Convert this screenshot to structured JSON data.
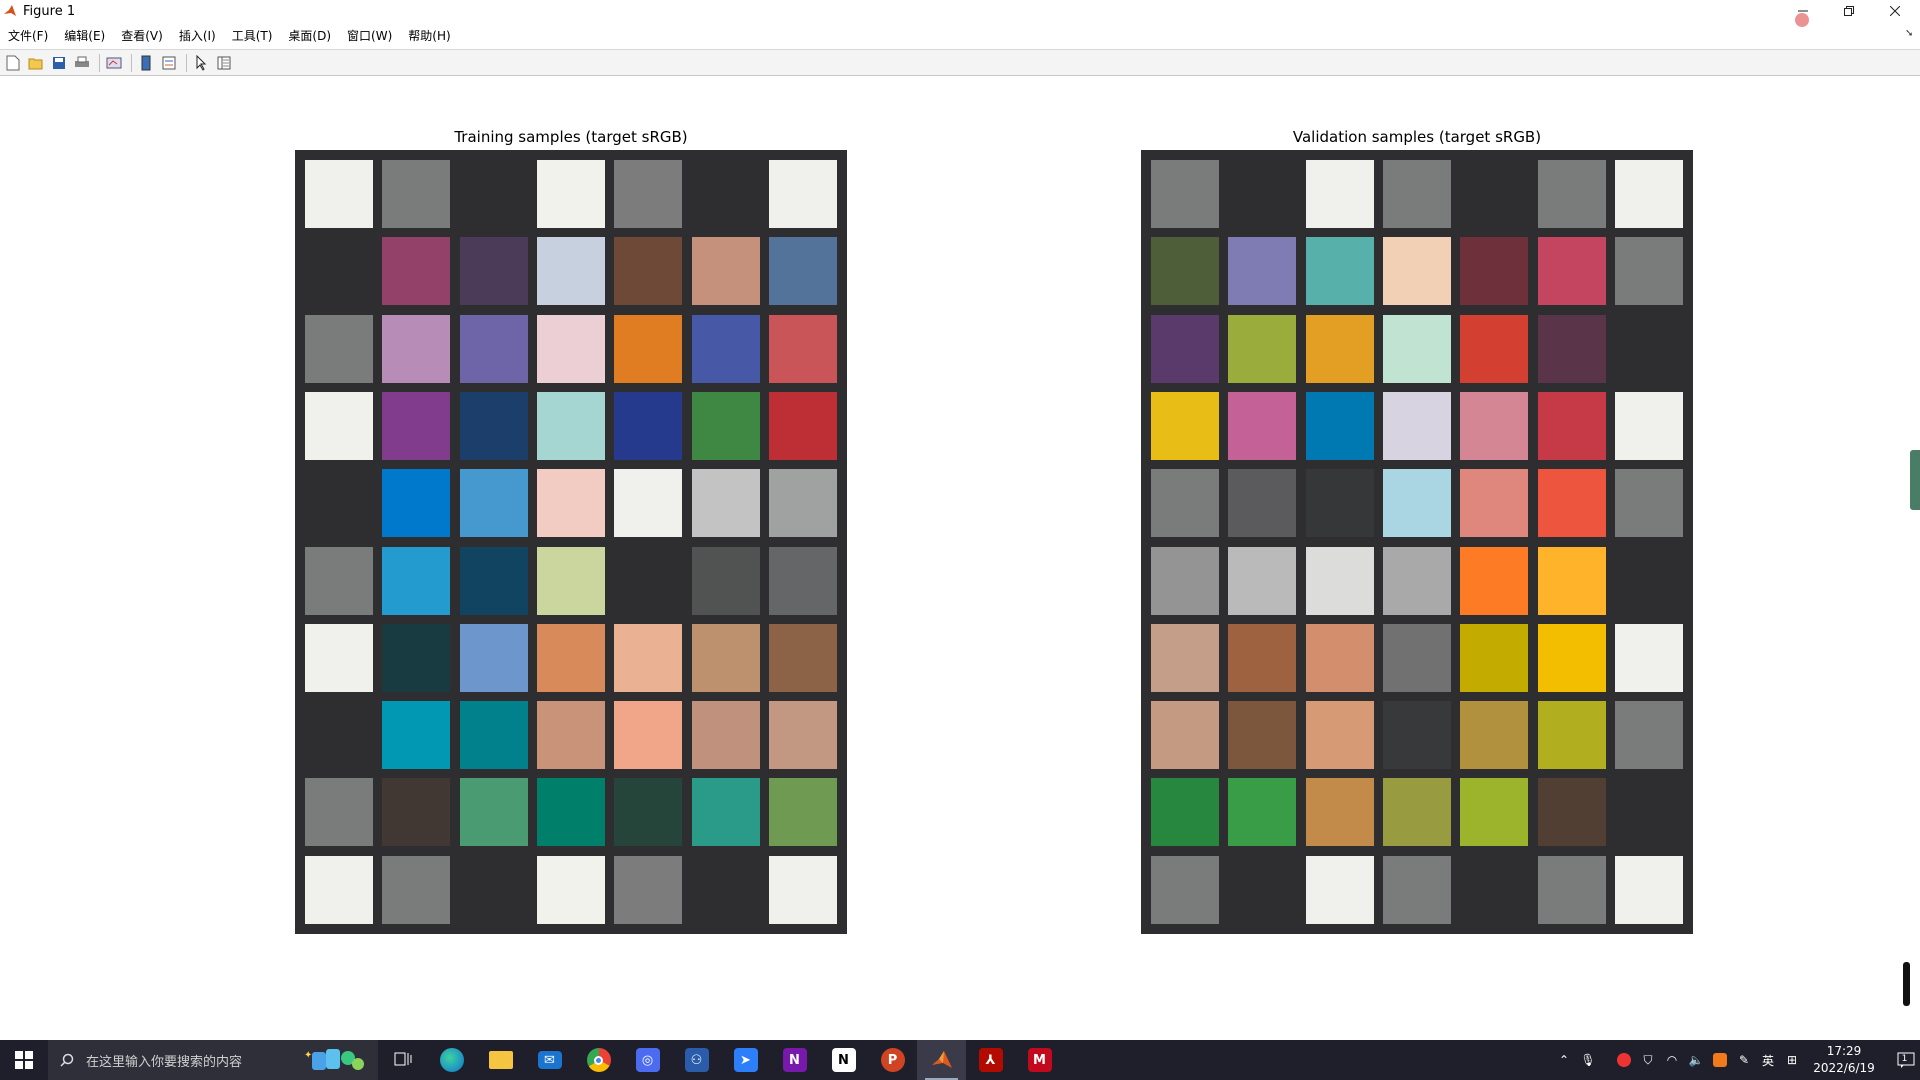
{
  "window": {
    "title": "Figure 1"
  },
  "menu": [
    "文件(F)",
    "编辑(E)",
    "查看(V)",
    "插入(I)",
    "工具(T)",
    "桌面(D)",
    "窗口(W)",
    "帮助(H)"
  ],
  "toolbar": {
    "buttons": [
      "new-figure-icon",
      "open-icon",
      "save-icon",
      "print-icon",
      "link-plot-icon",
      "colorbar-icon",
      "legend-icon",
      "edit-plot-icon",
      "property-inspector-icon"
    ]
  },
  "figure": {
    "training": {
      "title": "Training samples (target sRGB)",
      "colors": [
        [
          "#f0f1ed",
          "#7a7b7b",
          "#2e2e30",
          "#f1f2ec",
          "#7b7c7b",
          "#2e2e30",
          "#f0f1ec"
        ],
        [
          "#2e2e30",
          "#944169",
          "#4b3a58",
          "#c6d0de",
          "#6f4938",
          "#c6917c",
          "#54739b"
        ],
        [
          "#7a7b7b",
          "#b78db8",
          "#6d65a8",
          "#ecced5",
          "#e07d22",
          "#4758a7",
          "#c95558"
        ],
        [
          "#f0f1ed",
          "#813c8e",
          "#1c3e6a",
          "#a6d6d1",
          "#263a8d",
          "#3f8844",
          "#be2e35"
        ],
        [
          "#2e2e30",
          "#0079cc",
          "#4699cf",
          "#f2cbc2",
          "#f0f1ec",
          "#c3c3c3",
          "#a0a1a1"
        ],
        [
          "#7a7b7b",
          "#249bce",
          "#114460",
          "#cad69d",
          "#2e2e30",
          "#515252",
          "#656667"
        ],
        [
          "#f0f1ed",
          "#173b40",
          "#6d96cd",
          "#d88a5b",
          "#ebb193",
          "#bd916d",
          "#8c6347"
        ],
        [
          "#2e2e30",
          "#0098b2",
          "#00818b",
          "#c9937a",
          "#f1a68a",
          "#c0927d",
          "#c29882"
        ],
        [
          "#7a7b7b",
          "#423833",
          "#4a9a72",
          "#00806a",
          "#25453b",
          "#2a9b89",
          "#6f9a52"
        ],
        [
          "#f0f1ed",
          "#7a7b7b",
          "#2e2e30",
          "#f1f2ec",
          "#7b7c7b",
          "#2e2e30",
          "#f0f1ec"
        ]
      ]
    },
    "validation": {
      "title": "Validation samples (target sRGB)",
      "colors": [
        [
          "#7a7b7b",
          "#2e2e30",
          "#f0f1ec",
          "#7a7b7b",
          "#2e2e30",
          "#7a7b7b",
          "#f0f1ec"
        ],
        [
          "#4e5e39",
          "#7e7cb2",
          "#57b1aa",
          "#f1d0b5",
          "#6e313b",
          "#c44560",
          "#7a7b7b"
        ],
        [
          "#5a3a6b",
          "#9aad3c",
          "#e39f23",
          "#c0e3d2",
          "#d33f31",
          "#5a3549",
          "#2e2e30"
        ],
        [
          "#e8bd15",
          "#c46298",
          "#0078b1",
          "#d8d3e0",
          "#d58694",
          "#c63a48",
          "#f0f1ec"
        ],
        [
          "#7a7b7b",
          "#5b5a5d",
          "#363739",
          "#aad5e3",
          "#e0877d",
          "#ee553e",
          "#7a7b7b"
        ],
        [
          "#949495",
          "#bababa",
          "#dcdcdb",
          "#a9a9aa",
          "#fc7b24",
          "#ffb32a",
          "#2e2e30"
        ],
        [
          "#c49e89",
          "#9f6240",
          "#d38e6e",
          "#717171",
          "#c4ab00",
          "#f4be00",
          "#f0f1ec"
        ],
        [
          "#c49a83",
          "#7d573d",
          "#d69a74",
          "#38393b",
          "#b1913d",
          "#b1ae20",
          "#7a7b7b"
        ],
        [
          "#28873e",
          "#389d46",
          "#c38b4a",
          "#999b40",
          "#9bb42b",
          "#523f33",
          "#2e2e30"
        ],
        [
          "#7a7b7b",
          "#2e2e30",
          "#f0f1ec",
          "#7a7b7b",
          "#2e2e30",
          "#7a7b7b",
          "#f0f1ec"
        ]
      ]
    }
  },
  "taskbar": {
    "search_placeholder": "在这里输入你要搜索的内容",
    "apps": [
      "task-view-icon",
      "edge-icon",
      "file-explorer-icon",
      "mail-icon",
      "chrome-icon",
      "screen-capture-icon",
      "app-icon",
      "feishu-icon",
      "onenote-icon",
      "notion-icon",
      "powerpoint-icon",
      "matlab-icon",
      "acrobat-icon",
      "mendeley-icon"
    ],
    "tray": {
      "ime": "英",
      "time": "17:29",
      "date": "2022/6/19",
      "notifications": "1"
    }
  }
}
